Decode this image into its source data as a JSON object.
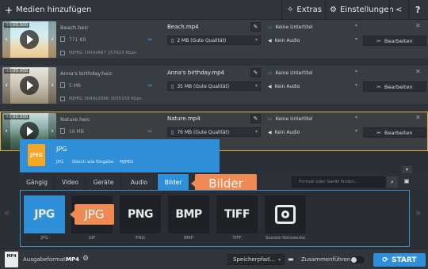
{
  "toolbar": {
    "add_media_label": "Medien hinzufügen",
    "extras_label": "Extras",
    "settings_label": "Einstellungen"
  },
  "files": [
    {
      "timecode": "00:00:000",
      "src_name": "Beach.heic",
      "src_size": "771 KB",
      "meta": "MJPEG 1000x667 157923 Kbps",
      "out_name": "Beach.mp4",
      "out_size": "2 MB (Gute Qualität)",
      "subtitle": "Keine Untertitel",
      "audio": "Kein Audio",
      "edit_label": "Bearbeiten"
    },
    {
      "timecode": "00:00:000",
      "src_name": "Anna's birthday.heic",
      "src_size": "5 MB",
      "meta": "MJPEG 3049x3366 3035159 Kbps",
      "out_name": "Anna's birthday.mp4",
      "out_size": "35 MB (Gute Qualität)",
      "subtitle": "Keine Untertitel",
      "audio": "Kein Audio",
      "edit_label": "Bearbeiten"
    },
    {
      "timecode": "00:00:000",
      "src_name": "Nature.heic",
      "src_size": "16 MB",
      "meta": "",
      "out_name": "Nature.mp4",
      "out_size": "76 MB (Gute Qualität)",
      "subtitle": "Keine Untertitel",
      "audio": "Kein Audio",
      "edit_label": "Bearbeiten"
    }
  ],
  "popup": {
    "title": "JPG",
    "format": "JPG",
    "same_as_input": "Gleich wie Eingabe",
    "codec": "MJPEG"
  },
  "tabs": [
    "Gängig",
    "Video",
    "Geräte",
    "Audio",
    "Bilder"
  ],
  "active_tab": "Bilder",
  "callouts": {
    "tab_hint": "Bilder",
    "format_hint": "JPG"
  },
  "search": {
    "placeholder": "Format oder Gerät finden..."
  },
  "formats": [
    {
      "glyph": "JPG",
      "label": "JPG"
    },
    {
      "glyph": "GIF",
      "label": "GIF"
    },
    {
      "glyph": "PNG",
      "label": "PNG"
    },
    {
      "glyph": "BMP",
      "label": "BMP"
    },
    {
      "glyph": "TIFF",
      "label": "TIFF"
    },
    {
      "glyph": "",
      "label": "Soziale Netzwerke"
    }
  ],
  "bottom": {
    "output_format_label": "Ausgabeformat:",
    "output_format_value": "MP4",
    "save_path_label": "Speicherpfad...",
    "merge_label": "Zusammenführen:",
    "convert_label": "START"
  },
  "colors": {
    "accent": "#2f8fd8",
    "callout": "#f08a54",
    "selection": "#e0b040"
  }
}
